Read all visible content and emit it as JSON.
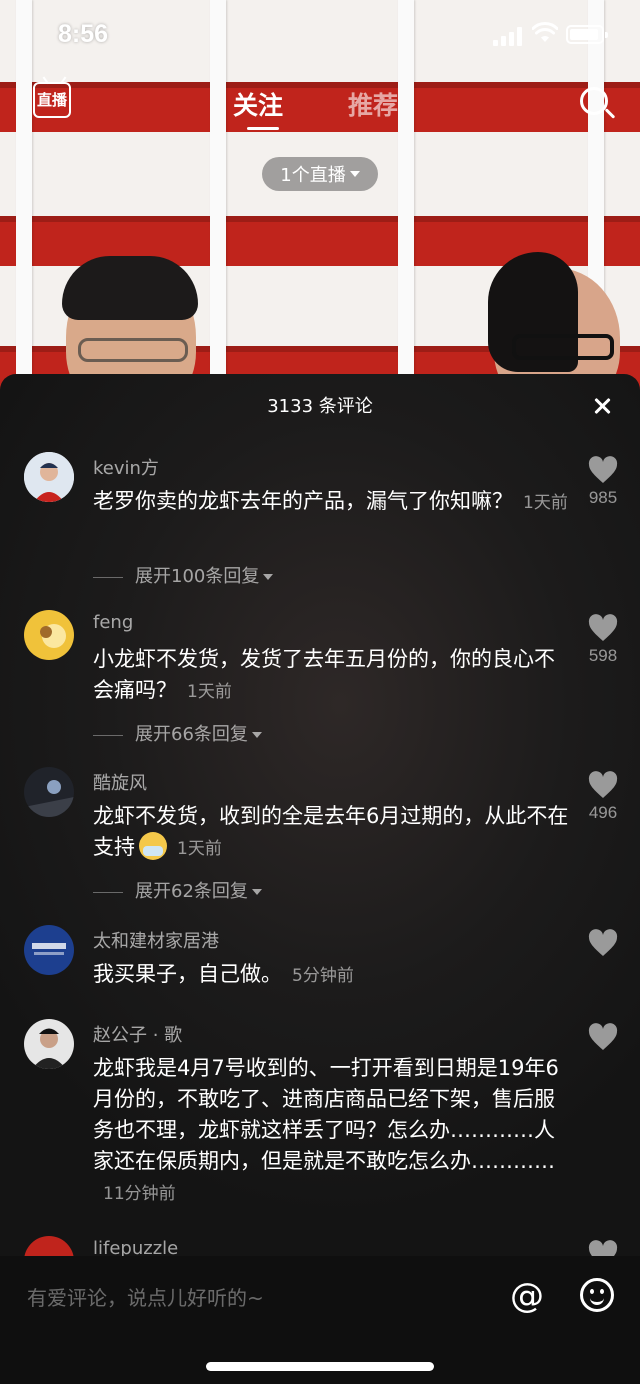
{
  "status_bar": {
    "time": "8:56"
  },
  "top_nav": {
    "live_icon_label": "直播",
    "tabs": [
      {
        "label": "关注",
        "active": true
      },
      {
        "label": "推荐",
        "active": false
      }
    ],
    "live_pill": "1个直播"
  },
  "comments_sheet": {
    "title": "3133 条评论",
    "comments": [
      {
        "user": "kevin方",
        "text": "老罗你卖的龙虾去年的产品，漏气了你知嘛？",
        "time": "1天前",
        "likes": "985",
        "replies": "展开100条回复",
        "avatar_color": "#3a6fb6"
      },
      {
        "user": "feng",
        "text": "小龙虾不发货，发货了去年五月份的，你的良心不会痛吗？",
        "time": "1天前",
        "likes": "598",
        "replies": "展开66条回复",
        "avatar_color": "#e8b634"
      },
      {
        "user": "酷旋风",
        "text": "龙虾不发货，收到的全是去年6月过期的，从此不在支持",
        "time": "1天前",
        "likes": "496",
        "replies": "展开62条回复",
        "avatar_color": "#2a2d33"
      },
      {
        "user": "太和建材家居港",
        "text": "我买果子，自己做。",
        "time": "5分钟前",
        "likes": "",
        "replies": "",
        "avatar_color": "#1d3f8f"
      },
      {
        "user": "赵公子 · 歌",
        "text": "龙虾我是4月7号收到的、一打开看到日期是19年6月份的，不敢吃了、进商店商品已经下架，售后服务也不理，龙虾就这样丢了吗？怎么办…………人家还在保质期内，但是就是不敢吃怎么办…………",
        "time": "11分钟前",
        "likes": "",
        "replies": "",
        "avatar_color": "#d9d9d9"
      },
      {
        "user": "lifepuzzle",
        "text": "",
        "time": "",
        "likes": "",
        "replies": "",
        "avatar_color": "#c0241c"
      }
    ]
  },
  "input_bar": {
    "placeholder": "有爱评论，说点儿好听的~"
  },
  "colors": {
    "sheet_bg": "#1c1b1b",
    "shelf_red": "#c0241c"
  }
}
